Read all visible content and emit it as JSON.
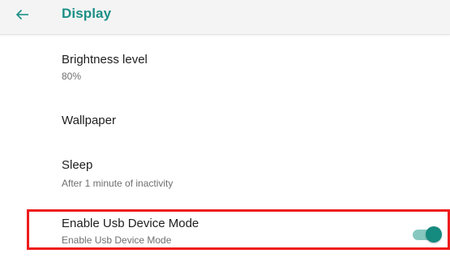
{
  "app_bar": {
    "title": "Display",
    "back_icon": "arrow-back-icon",
    "accent_color": "#1d8f86"
  },
  "preferences": [
    {
      "title": "Brightness level",
      "summary": "80%"
    },
    {
      "title": "Wallpaper"
    },
    {
      "title": "Sleep",
      "summary": "After 1 minute of inactivity"
    },
    {
      "title": "Enable Usb Device Mode",
      "summary": "Enable Usb Device Mode",
      "switch_on": true
    }
  ],
  "highlight_color": "#ee1c1c",
  "switch_color": "#158a7f"
}
